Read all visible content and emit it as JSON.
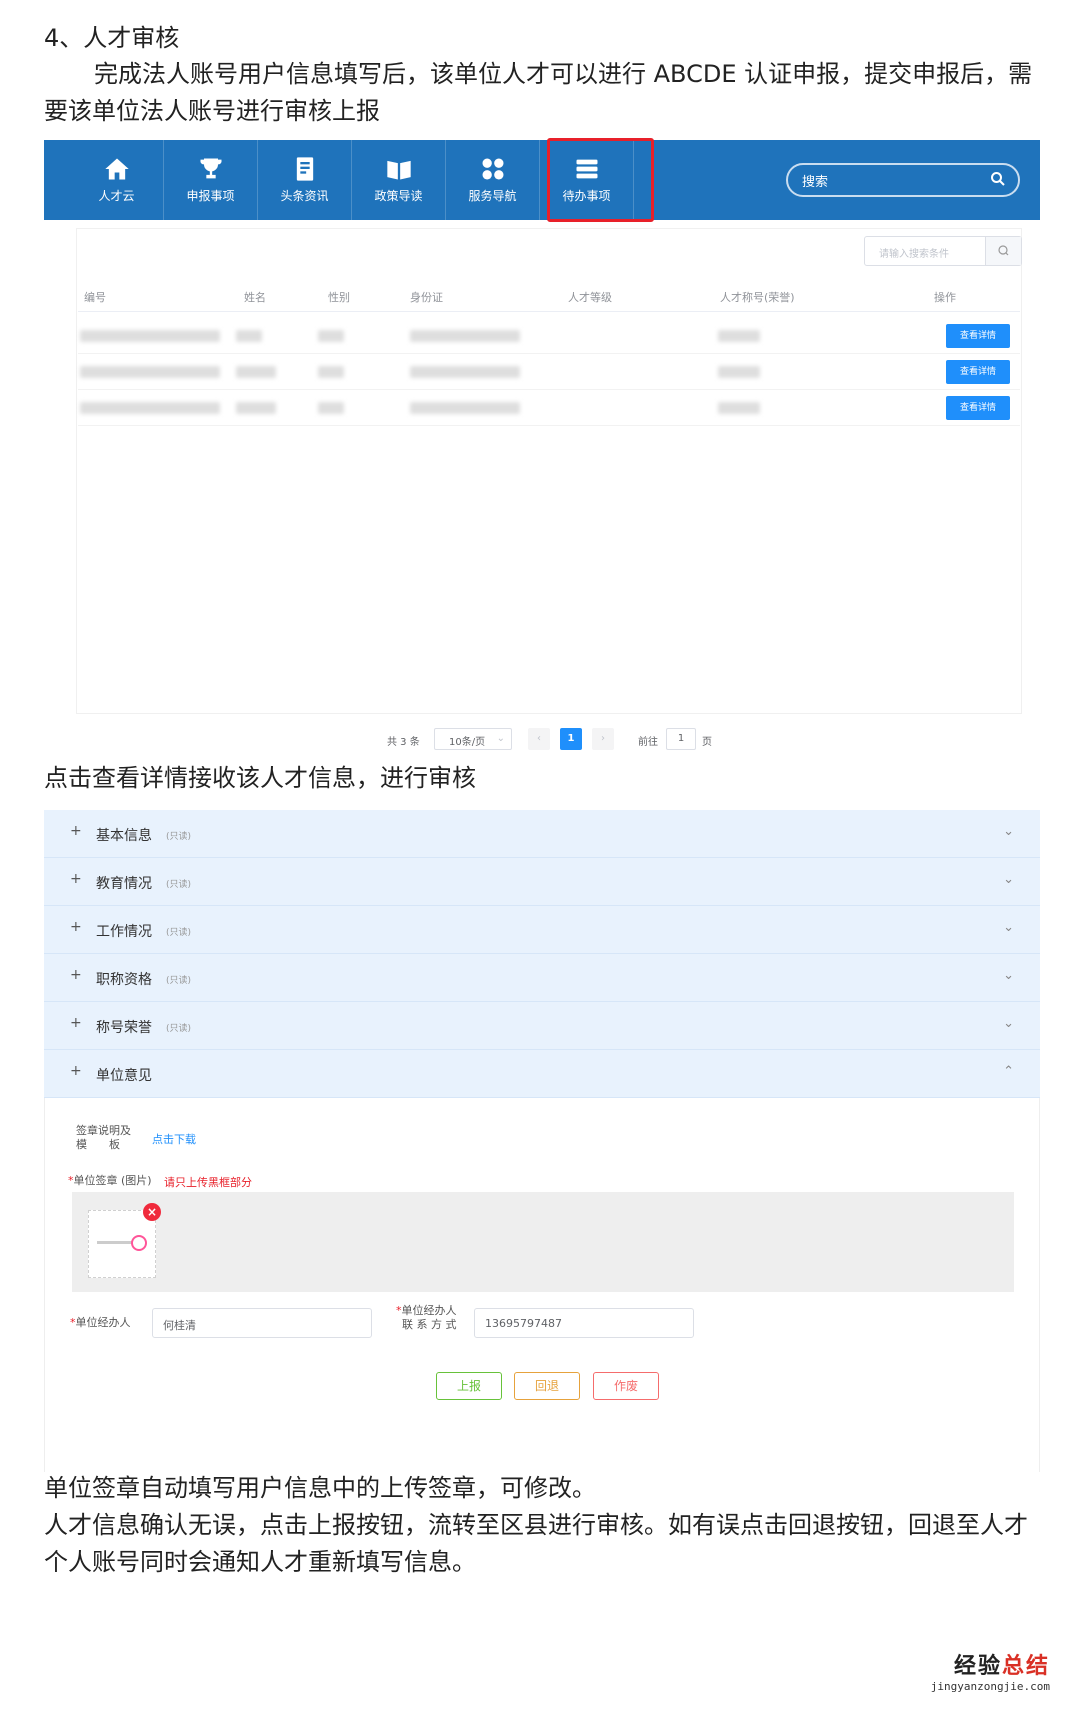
{
  "article": {
    "heading": "4、人才审核",
    "intro": "完成法人账号用户信息填写后，该单位人才可以进行 ABCDE 认证申报，提交申报后，需要该单位法人账号进行审核上报",
    "step_text": "点击查看详情接收该人才信息，进行审核",
    "outro_line1": "单位签章自动填写用户信息中的上传签章，可修改。",
    "outro_line2": "人才信息确认无误，点击上报按钮，流转至区县进行审核。如有误点击回退按钮，回退至人才个人账号同时会通知人才重新填写信息。"
  },
  "nav": {
    "items": [
      {
        "label": "人才云",
        "icon": "home-icon"
      },
      {
        "label": "申报事项",
        "icon": "trophy-icon"
      },
      {
        "label": "头条资讯",
        "icon": "document-icon"
      },
      {
        "label": "政策导读",
        "icon": "book-icon"
      },
      {
        "label": "服务导航",
        "icon": "grid-icon"
      },
      {
        "label": "待办事项",
        "icon": "list-icon"
      }
    ],
    "search_label": "搜索",
    "highlight_color": "#e8202a",
    "bg_color": "#1f73bb"
  },
  "table": {
    "search_placeholder": "请输入搜索条件",
    "columns": [
      "编号",
      "姓名",
      "性别",
      "身份证",
      "人才等级",
      "人才称号(荣誉)",
      "操作"
    ],
    "row_button": "查看详情",
    "row_count": 3
  },
  "pagination": {
    "total": "共 3 条",
    "page_size": "10条/页",
    "current": "1",
    "goto_label": "前往",
    "goto_value": "1",
    "page_suffix": "页"
  },
  "accordion": {
    "readonly_tag": "(只读)",
    "sections": [
      {
        "title": "基本信息"
      },
      {
        "title": "教育情况"
      },
      {
        "title": "工作情况"
      },
      {
        "title": "职称资格"
      },
      {
        "title": "称号荣誉"
      },
      {
        "title": "单位意见"
      }
    ]
  },
  "form": {
    "seal_note_label_1": "签章说明及",
    "seal_note_label_2": "模　　板",
    "seal_download": "点击下载",
    "seal_label": "单位签章 (图片)",
    "seal_warning": "请只上传黑框部分",
    "handler_label": "单位经办人",
    "handler_value": "何桂清",
    "contact_label_1": "单位经办人",
    "contact_label_2": "联 系 方 式",
    "contact_value": "13695797487",
    "btn_submit": "上报",
    "btn_return": "回退",
    "btn_void": "作废"
  },
  "watermark": {
    "brand_black": "经验",
    "brand_red": "总结",
    "url": "jingyanzongjie.com"
  }
}
